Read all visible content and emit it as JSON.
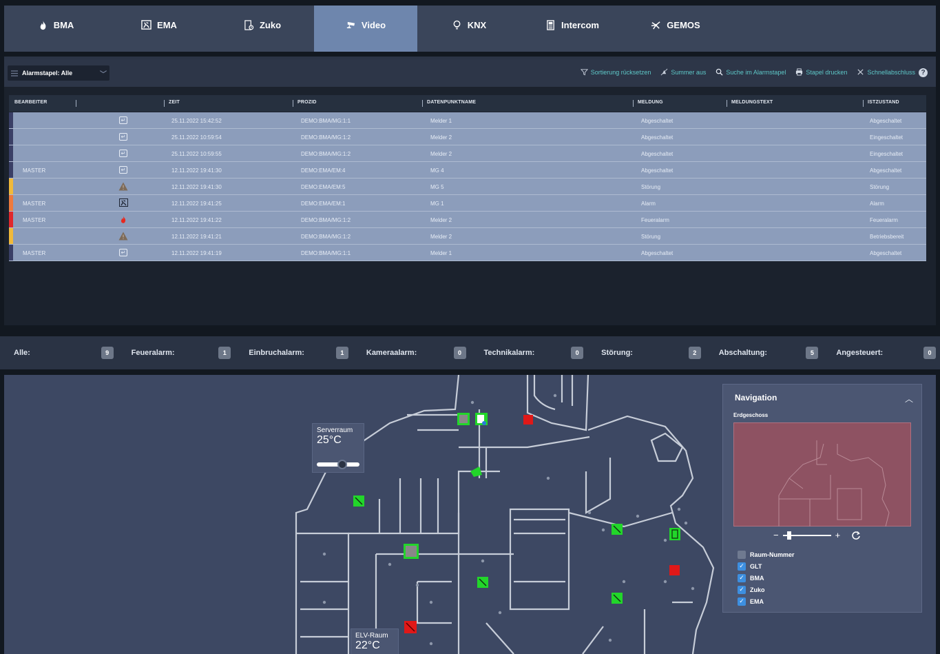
{
  "nav": {
    "tabs": [
      {
        "label": "BMA",
        "icon": "flame-icon",
        "active": false
      },
      {
        "label": "EMA",
        "icon": "intrusion-icon",
        "active": false
      },
      {
        "label": "Zuko",
        "icon": "access-control-icon",
        "active": false
      },
      {
        "label": "Video",
        "icon": "camera-icon",
        "active": true
      },
      {
        "label": "KNX",
        "icon": "bulb-icon",
        "active": false
      },
      {
        "label": "Intercom",
        "icon": "intercom-icon",
        "active": false
      },
      {
        "label": "GEMOS",
        "icon": "gemos-icon",
        "active": false
      }
    ]
  },
  "toolbar": {
    "stack_select": "Alarmstapel: Alle",
    "actions": [
      {
        "label": "Sortierung rücksetzen",
        "icon": "filter-reset-icon"
      },
      {
        "label": "Summer aus",
        "icon": "buzzer-off-icon"
      },
      {
        "label": "Suche im Alarmstapel",
        "icon": "search-icon"
      },
      {
        "label": "Stapel drucken",
        "icon": "print-icon"
      },
      {
        "label": "Schnellabschluss",
        "icon": "close-icon"
      }
    ],
    "help": "?"
  },
  "table": {
    "headers": {
      "bearbeiter": "BEARBEITER",
      "zeit": "ZEIT",
      "prozid": "PROZID",
      "dpname": "DATENPUNKTNAME",
      "meldung": "MELDUNG",
      "meldungstext": "MELDUNGSTEXT",
      "istzustand": "ISTZUSTAND"
    },
    "rows": [
      {
        "bearbeiter": "",
        "icon": "acknowledge-icon",
        "stripe": "#3a3f66",
        "zeit": "25.11.2022 15:42:52",
        "prozid": "DEMO:BMA/MG:1:1",
        "dp": "Melder 1",
        "meldung": "Abgeschaltet",
        "text": "",
        "ist": "Abgeschaltet"
      },
      {
        "bearbeiter": "",
        "icon": "acknowledge-icon",
        "stripe": "#3a3f66",
        "zeit": "25.11.2022 10:59:54",
        "prozid": "DEMO:BMA/MG:1:2",
        "dp": "Melder 2",
        "meldung": "Abgeschaltet",
        "text": "",
        "ist": "Eingeschaltet"
      },
      {
        "bearbeiter": "",
        "icon": "acknowledge-icon",
        "stripe": "#3a3f66",
        "zeit": "25.11.2022 10:59:55",
        "prozid": "DEMO:BMA/MG:1:2",
        "dp": "Melder 2",
        "meldung": "Abgeschaltet",
        "text": "",
        "ist": "Eingeschaltet"
      },
      {
        "bearbeiter": "MASTER",
        "icon": "acknowledge-icon",
        "stripe": "#3a3f66",
        "zeit": "12.11.2022 19:41:30",
        "prozid": "DEMO:EMA/EM:4",
        "dp": "MG 4",
        "meldung": "Abgeschaltet",
        "text": "",
        "ist": "Abgeschaltet"
      },
      {
        "bearbeiter": "",
        "icon": "warning-icon",
        "stripe": "#f0b93a",
        "zeit": "12.11.2022 19:41:30",
        "prozid": "DEMO:EMA/EM:5",
        "dp": "MG 5",
        "meldung": "Störung",
        "text": "",
        "ist": "Störung"
      },
      {
        "bearbeiter": "MASTER",
        "icon": "intrusion-icon",
        "stripe": "#ee7a3c",
        "zeit": "12.11.2022 19:41:25",
        "prozid": "DEMO:EMA/EM:1",
        "dp": "MG 1",
        "meldung": "Alarm",
        "text": "",
        "ist": "Alarm"
      },
      {
        "bearbeiter": "MASTER",
        "icon": "flame-icon",
        "stripe": "#e0282c",
        "zeit": "12.11.2022 19:41:22",
        "prozid": "DEMO:BMA/MG:1:2",
        "dp": "Melder 2",
        "meldung": "Feueralarm",
        "text": "",
        "ist": "Feueralarm"
      },
      {
        "bearbeiter": "",
        "icon": "warning-icon",
        "stripe": "#f0b93a",
        "zeit": "12.11.2022 19:41:21",
        "prozid": "DEMO:BMA/MG:1:2",
        "dp": "Melder 2",
        "meldung": "Störung",
        "text": "",
        "ist": "Betriebsbereit"
      },
      {
        "bearbeiter": "MASTER",
        "icon": "acknowledge-icon",
        "stripe": "#3a3f66",
        "zeit": "12.11.2022 19:41:19",
        "prozid": "DEMO:BMA/MG:1:1",
        "dp": "Melder 1",
        "meldung": "Abgeschaltet",
        "text": "",
        "ist": "Abgeschaltet"
      }
    ]
  },
  "counters": [
    {
      "label": "Alle:",
      "value": "9"
    },
    {
      "label": "Feueralarm:",
      "value": "1"
    },
    {
      "label": "Einbruchalarm:",
      "value": "1"
    },
    {
      "label": "Kameraalarm:",
      "value": "0"
    },
    {
      "label": "Technikalarm:",
      "value": "0"
    },
    {
      "label": "Störung:",
      "value": "2"
    },
    {
      "label": "Abschaltung:",
      "value": "5"
    },
    {
      "label": "Angesteuert:",
      "value": "0"
    }
  ],
  "plan": {
    "rooms": [
      {
        "name": "Serverraum",
        "temp": "25°C"
      },
      {
        "name": "ELV-Raum",
        "temp": "22°C"
      }
    ],
    "status_colors": {
      "ok": "#22d62a",
      "alarm": "#e01818",
      "neutral": "#888888"
    }
  },
  "navigation": {
    "title": "Navigation",
    "floor": "Erdgeschoss",
    "collapse_icon": "chevron-up-icon",
    "zoom_minus": "−",
    "zoom_plus": "+",
    "reset_icon": "refresh-icon",
    "layers": [
      {
        "label": "Raum-Nummer",
        "checked": false
      },
      {
        "label": "GLT",
        "checked": true
      },
      {
        "label": "BMA",
        "checked": true
      },
      {
        "label": "Zuko",
        "checked": true
      },
      {
        "label": "EMA",
        "checked": true
      }
    ]
  },
  "colors": {
    "accent": "#5ec8c8",
    "active_tab": "#6e86ad",
    "row": "#8c9dbb"
  }
}
